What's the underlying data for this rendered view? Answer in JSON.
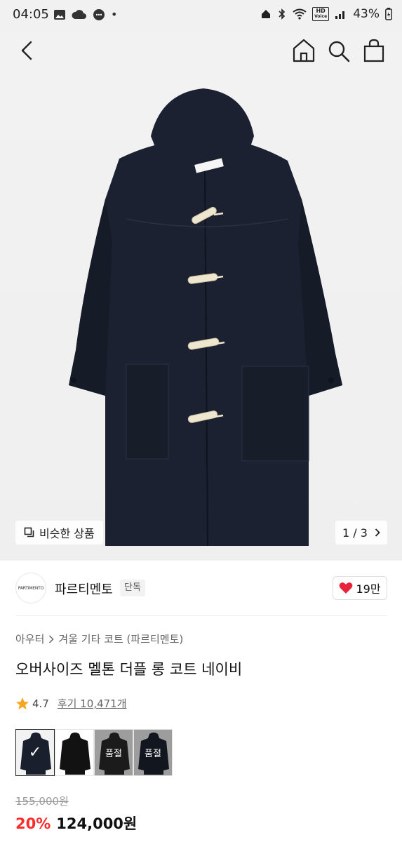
{
  "status_bar": {
    "time": "04:05",
    "battery": "43%",
    "hd_badge_line1": "HD",
    "hd_badge_line2": "Voice"
  },
  "nav": {
    "back_icon": "chevron-left-icon",
    "home_icon": "home-icon",
    "search_icon": "search-icon",
    "bag_icon": "shopping-bag-icon"
  },
  "image": {
    "similar_label": "비슷한 상품",
    "page_indicator": "1 / 3"
  },
  "brand": {
    "logo_text": "PARTIMENTO",
    "name": "파르티멘토",
    "badge": "단독",
    "like_count": "19만"
  },
  "product": {
    "breadcrumb": [
      "아우터",
      "겨울 기타 코트 (파르티멘토)"
    ],
    "title": "오버사이즈 멜톤 더플 롱 코트 네이비",
    "rating": "4.7",
    "reviews": "후기 10,471개",
    "original_price": "155,000원",
    "discount": "20%",
    "sale_price": "124,000원"
  },
  "color_options": [
    {
      "color": "#1a1f2e",
      "selected": true,
      "label": ""
    },
    {
      "color": "#121212",
      "selected": false,
      "label": ""
    },
    {
      "color": "#2a2a2a",
      "selected": false,
      "label": "품절"
    },
    {
      "color": "#1c2230",
      "selected": false,
      "label": "품절"
    }
  ],
  "colors": {
    "accent_red": "#ff2a2a",
    "heart": "#e8233a",
    "star": "#f5a623",
    "coat_navy": "#1b2130",
    "toggle": "#efe6cf"
  }
}
